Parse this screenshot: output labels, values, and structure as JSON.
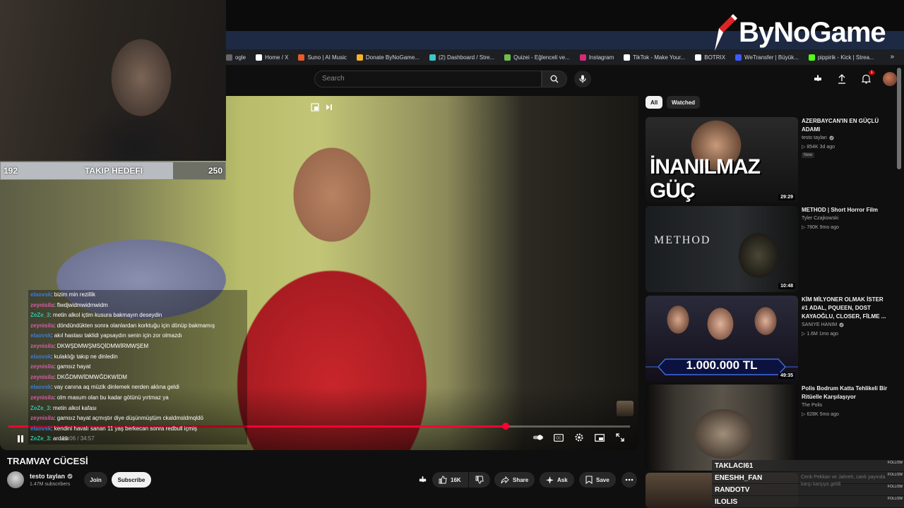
{
  "browser": {
    "bookmarks": [
      {
        "label": "ogle",
        "color": "#666666"
      },
      {
        "label": "Home / X",
        "color": "#ffffff"
      },
      {
        "label": "Suno | AI Music",
        "color": "#e85a2b"
      },
      {
        "label": "Donate ByNoGame...",
        "color": "#f3b32a"
      },
      {
        "label": "(2) Dashboard / Stre...",
        "color": "#3ec5c5"
      },
      {
        "label": "Quizei - Eğlenceli ve...",
        "color": "#6fbf4a"
      },
      {
        "label": "Instagram",
        "color": "#d62976"
      },
      {
        "label": "TikTok - Make Your...",
        "color": "#ffffff"
      },
      {
        "label": "BOTRIX",
        "color": "#ffffff"
      },
      {
        "label": "WeTransfer | Büyük...",
        "color": "#3d5afe"
      },
      {
        "label": "pippirik - Kick | Strea...",
        "color": "#53fc18"
      }
    ],
    "more": "»"
  },
  "brand": {
    "name": "ByNoGame"
  },
  "youtube": {
    "search_placeholder": "Search",
    "notification_count": "1"
  },
  "player": {
    "time": "23:06 / 34:57",
    "progress": 0.8
  },
  "overlay": {
    "goal": {
      "title": "TAKIP HEDEFI",
      "current": "192",
      "target": "250",
      "progress": 0.77
    },
    "chat": [
      {
        "user": "elaovsk",
        "color": "#3b7dd8",
        "msg": ": bizim min rezillik"
      },
      {
        "user": "zeynisila",
        "color": "#d65ea8",
        "msg": ": flwdjwidmwidmwidm"
      },
      {
        "user": "ZeZe_3",
        "color": "#32c3a6",
        "msg": ": metin alkol içtim kusura bakmayın deseydin"
      },
      {
        "user": "zeynisila",
        "color": "#d65ea8",
        "msg": ": döndündükten sonra olanlardan korktuğu için dönüp bakmamış"
      },
      {
        "user": "elaovsk",
        "color": "#3b7dd8",
        "msg": ": akıl hastası taklidi yapsaydın senin için zor olmazdı"
      },
      {
        "user": "zeynisila",
        "color": "#d65ea8",
        "msg": ": DKWŞDMWŞMSQİDMWİRMWŞEM"
      },
      {
        "user": "elaovsk",
        "color": "#3b7dd8",
        "msg": ": kulaklığı takıp ne dinledin"
      },
      {
        "user": "zeynisila",
        "color": "#d65ea8",
        "msg": ": gamsız hayat"
      },
      {
        "user": "zeynisila",
        "color": "#d65ea8",
        "msg": ": DKĞDMWİDMWĞDKWİDM"
      },
      {
        "user": "elaovsk",
        "color": "#3b7dd8",
        "msg": ": vay canına aq müzik dinlemek nerden aklına geldi"
      },
      {
        "user": "zeynisila",
        "color": "#d65ea8",
        "msg": ": olm masum olan bu kadar götünü yırtmaz ya"
      },
      {
        "user": "ZeZe_3",
        "color": "#32c3a6",
        "msg": ": metin alkol kafası"
      },
      {
        "user": "zeynisila",
        "color": "#d65ea8",
        "msg": ": gamsız hayat açmıştır diye düşünmüştüm ckaldmsldmqldö"
      },
      {
        "user": "elaovsk",
        "color": "#3b7dd8",
        "msg": ": kendini havalı sanan 11 yaş berkecan sonra redbull içmiş"
      },
      {
        "user": "ZeZe_3",
        "color": "#32c3a6",
        "msg": ": ardası"
      }
    ],
    "follows": [
      {
        "name": "TAKLACI61",
        "tag": "FOLLOW"
      },
      {
        "name": "ENESHH_FAN",
        "tag": "FOLLOW"
      },
      {
        "name": "RANDOTV",
        "tag": "FOLLOW"
      },
      {
        "name": "ILOLIS",
        "tag": "FOLLOW"
      }
    ],
    "follow_ghost": "Cenk Pekkan ve Jahreh, canlı yayında karşı karşıya geldi"
  },
  "video": {
    "title": "TRAMVAY CÜCESİ",
    "channel": "testo taylan",
    "subscribers": "1.47M subscribers",
    "join": "Join",
    "subscribe": "Subscribe",
    "likes": "16K",
    "share": "Share",
    "ask": "Ask",
    "save": "Save"
  },
  "sidebar": {
    "chips": [
      "All",
      "Watched"
    ],
    "recommendations": [
      {
        "title": "AZERBAYCAN'IN EN GÜÇLÜ ADAMI",
        "channel": "testo taylan",
        "verified": true,
        "meta": "▷ 854K  3d ago",
        "badge": "New",
        "duration": "29:29",
        "thumb_text": "İNANILMAZ GÜÇ"
      },
      {
        "title": "METHOD | Short Horror Film",
        "channel": "Tyler Czajkowski",
        "verified": false,
        "meta": "▷ 780K  9mo ago",
        "badge": "",
        "duration": "10:48",
        "thumb_text": "METHOD"
      },
      {
        "title": "KİM MİLYONER OLMAK İSTER #1 ADAL, PQUEEN, DOST KAYAOĞLU, CLOSER, FİLME ...",
        "channel": "SANIYE HANIM",
        "verified": true,
        "meta": "▷ 1.6M  1mo ago",
        "badge": "",
        "duration": "49:35",
        "thumb_text": "1.000.000 TL"
      },
      {
        "title": "Polis Bodrum Katta Tehlikeli Bir Ritüelle Karşılaşıyor",
        "channel": "The Polis",
        "verified": false,
        "meta": "▷ 628K  5mo ago",
        "badge": "",
        "duration": "",
        "thumb_text": ""
      }
    ]
  }
}
